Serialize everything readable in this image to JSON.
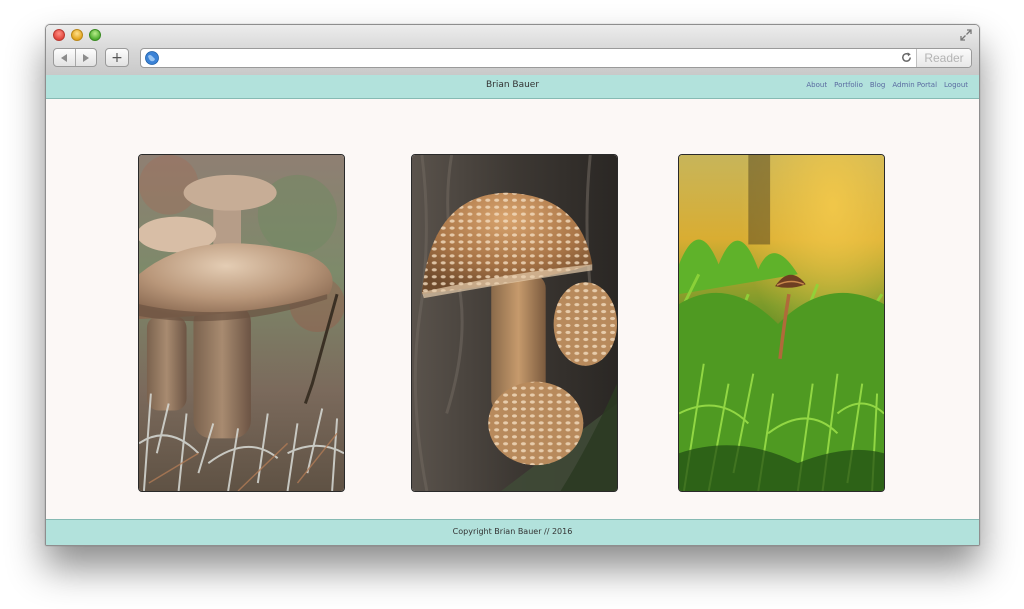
{
  "browser": {
    "address": {
      "value": "",
      "placeholder": ""
    },
    "reader_label": "Reader",
    "new_tab_glyph": "+"
  },
  "site": {
    "title": "Brian Bauer",
    "nav": [
      {
        "label": "About"
      },
      {
        "label": "Portfolio"
      },
      {
        "label": "Blog"
      },
      {
        "label": "Admin Portal"
      },
      {
        "label": "Logout"
      }
    ],
    "footer": "Copyright Brian Bauer // 2016"
  },
  "gallery": {
    "photos": [
      {
        "subject": "bolete mushrooms among reindeer lichen"
      },
      {
        "subject": "scaly mushrooms growing from tree bark"
      },
      {
        "subject": "tiny mushroom in green moss"
      }
    ]
  },
  "colors": {
    "header_bg": "#b2e2dc",
    "page_bg": "#fcf8f6",
    "nav_link": "#5a6aa0"
  },
  "icons": [
    "back-arrow-icon",
    "forward-arrow-icon",
    "globe-icon",
    "reload-icon",
    "fullscreen-icon"
  ]
}
